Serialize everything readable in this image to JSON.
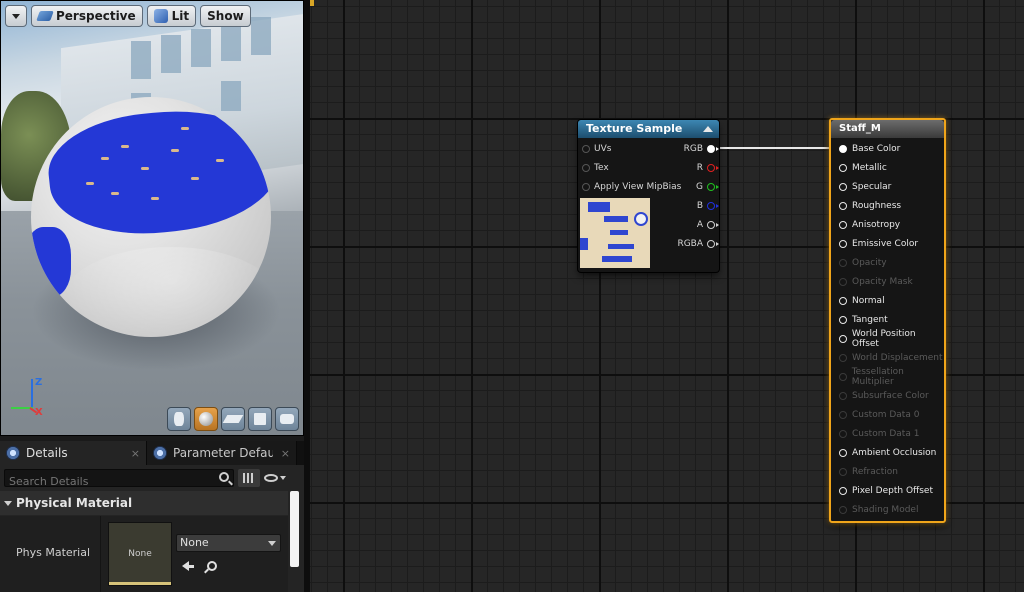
{
  "viewport": {
    "toolbar": {
      "perspective_label": "Perspective",
      "lit_label": "Lit",
      "show_label": "Show"
    },
    "axis": {
      "z": "Z",
      "x": "X",
      "y": "Y"
    },
    "preview_shapes": [
      "cylinder",
      "sphere",
      "plane",
      "cube",
      "custom-mesh"
    ],
    "active_preview_shape": "sphere"
  },
  "details": {
    "tabs": [
      {
        "label": "Details",
        "close": "×"
      },
      {
        "label": "Parameter Defaults",
        "close": "×"
      }
    ],
    "search_placeholder": "Search Details",
    "category": "Physical Material",
    "property": {
      "label": "Phys Material",
      "thumbnail_text": "None",
      "value": "None"
    }
  },
  "graph": {
    "texture_node": {
      "title": "Texture Sample",
      "inputs": [
        "UVs",
        "Tex",
        "Apply View MipBias"
      ],
      "outputs": [
        {
          "label": "RGB",
          "color": "#ffffff",
          "connected": true
        },
        {
          "label": "R",
          "color": "#e02020",
          "connected": false
        },
        {
          "label": "G",
          "color": "#20c020",
          "connected": false
        },
        {
          "label": "B",
          "color": "#2030e0",
          "connected": false
        },
        {
          "label": "A",
          "color": "#d0d0d0",
          "connected": false
        },
        {
          "label": "RGBA",
          "color": "#d0d0d0",
          "connected": false
        }
      ]
    },
    "material_node": {
      "title": "Staff_M",
      "accent": "#f0a51a",
      "pins": [
        {
          "label": "Base Color",
          "enabled": true,
          "connected": true
        },
        {
          "label": "Metallic",
          "enabled": true,
          "connected": false
        },
        {
          "label": "Specular",
          "enabled": true,
          "connected": false
        },
        {
          "label": "Roughness",
          "enabled": true,
          "connected": false
        },
        {
          "label": "Anisotropy",
          "enabled": true,
          "connected": false
        },
        {
          "label": "Emissive Color",
          "enabled": true,
          "connected": false
        },
        {
          "label": "Opacity",
          "enabled": false,
          "connected": false
        },
        {
          "label": "Opacity Mask",
          "enabled": false,
          "connected": false
        },
        {
          "label": "Normal",
          "enabled": true,
          "connected": false
        },
        {
          "label": "Tangent",
          "enabled": true,
          "connected": false
        },
        {
          "label": "World Position Offset",
          "enabled": true,
          "connected": false
        },
        {
          "label": "World Displacement",
          "enabled": false,
          "connected": false
        },
        {
          "label": "Tessellation Multiplier",
          "enabled": false,
          "connected": false
        },
        {
          "label": "Subsurface Color",
          "enabled": false,
          "connected": false
        },
        {
          "label": "Custom Data 0",
          "enabled": false,
          "connected": false
        },
        {
          "label": "Custom Data 1",
          "enabled": false,
          "connected": false
        },
        {
          "label": "Ambient Occlusion",
          "enabled": true,
          "connected": false
        },
        {
          "label": "Refraction",
          "enabled": false,
          "connected": false
        },
        {
          "label": "Pixel Depth Offset",
          "enabled": true,
          "connected": false
        },
        {
          "label": "Shading Model",
          "enabled": false,
          "connected": false
        }
      ]
    }
  }
}
